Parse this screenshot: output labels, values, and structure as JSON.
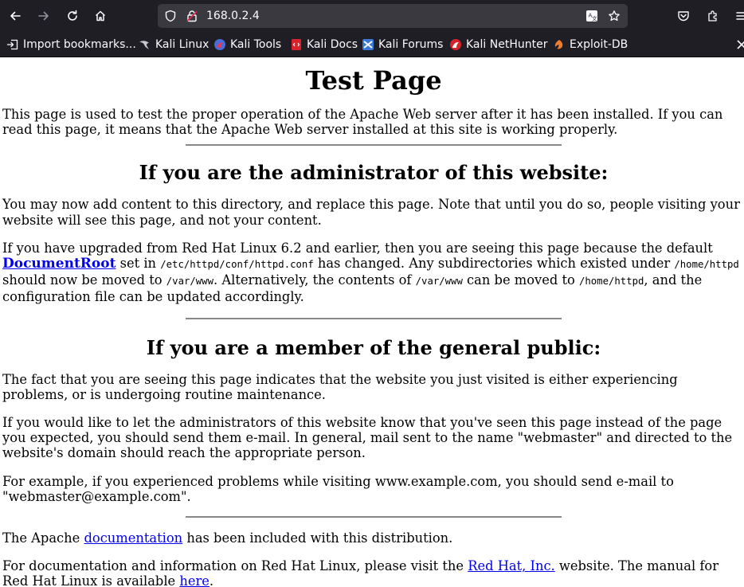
{
  "browser": {
    "url": "168.0.2.4",
    "bookmarks": [
      {
        "label": "Import bookmarks..."
      },
      {
        "label": "Kali Linux"
      },
      {
        "label": "Kali Tools"
      },
      {
        "label": "Kali Docs"
      },
      {
        "label": "Kali Forums"
      },
      {
        "label": "Kali NetHunter"
      },
      {
        "label": "Exploit-DB"
      }
    ]
  },
  "page": {
    "title": "Test Page",
    "intro": "This page is used to test the proper operation of the Apache Web server after it has been installed. If you can read this page, it means that the Apache Web server installed at this site is working properly.",
    "admin": {
      "heading": "If you are the administrator of this website:",
      "p1": "You may now add content to this directory, and replace this page. Note that until you do so, people visiting your website will see this page, and not your content.",
      "p2": {
        "part1": "If you have upgraded from Red Hat Linux 6.2 and earlier, then you are seeing this page because the default ",
        "link": "DocumentRoot",
        "part2": " set in ",
        "code1": "/etc/httpd/conf/httpd.conf",
        "part3": " has changed. Any subdirectories which existed under ",
        "code2": "/home/httpd",
        "part4": " should now be moved to ",
        "code3": "/var/www",
        "part5": ". Alternatively, the contents of ",
        "code4": "/var/www",
        "part6": " can be moved to ",
        "code5": "/home/httpd",
        "part7": ", and the configuration file can be updated accordingly."
      }
    },
    "public": {
      "heading": "If you are a member of the general public:",
      "p1": "The fact that you are seeing this page indicates that the website you just visited is either experiencing problems, or is undergoing routine maintenance.",
      "p2": "If you would like to let the administrators of this website know that you've seen this page instead of the page you expected, you should send them e-mail. In general, mail sent to the name \"webmaster\" and directed to the website's domain should reach the appropriate person.",
      "p3": "For example, if you experienced problems while visiting www.example.com, you should send e-mail to \"webmaster@example.com\"."
    },
    "footer": {
      "p1": {
        "part1": "The Apache ",
        "link": "documentation",
        "part2": " has been included with this distribution."
      },
      "p2": {
        "part1": "For documentation and information on Red Hat Linux, please visit the ",
        "link1": "Red Hat, Inc.",
        "part2": " website. The manual for Red Hat Linux is available ",
        "link2": "here",
        "part3": "."
      }
    }
  }
}
